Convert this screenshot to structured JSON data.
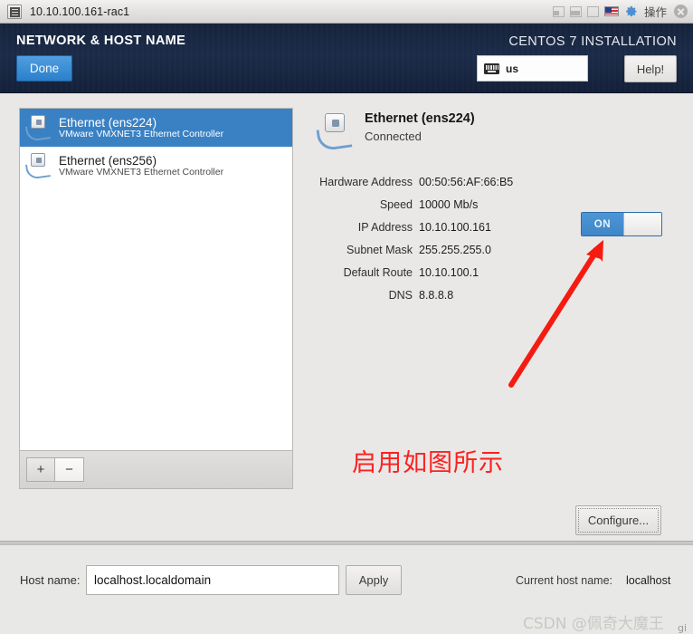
{
  "titlebar": {
    "title": "10.10.100.161-rac1",
    "icon": "terminal-icon",
    "buttons": {
      "minimize": "minimize-icon",
      "restore": "restore-icon",
      "maximize": "maximize-icon",
      "flag": "us-flag-icon",
      "gear": "gear-icon",
      "operation_label": "操作",
      "close": "close-icon"
    }
  },
  "header": {
    "screen_title": "NETWORK & HOST NAME",
    "done_label": "Done",
    "product_title": "CENTOS 7 INSTALLATION",
    "keyboard_layout": "us",
    "help_label": "Help!",
    "bg_color": "#1b2c49",
    "accent_color": "#3a81c4"
  },
  "devices": [
    {
      "name": "Ethernet (ens224)",
      "description": "VMware VMXNET3 Ethernet Controller",
      "selected": true
    },
    {
      "name": "Ethernet (ens256)",
      "description": "VMware VMXNET3 Ethernet Controller",
      "selected": false
    }
  ],
  "device_list_footer": {
    "add_label": "+",
    "remove_label": "−"
  },
  "detail": {
    "name": "Ethernet (ens224)",
    "state": "Connected",
    "toggle_label": "ON",
    "properties": [
      {
        "label": "Hardware Address",
        "value": "00:50:56:AF:66:B5"
      },
      {
        "label": "Speed",
        "value": "10000 Mb/s"
      },
      {
        "label": "IP Address",
        "value": "10.10.100.161"
      },
      {
        "label": "Subnet Mask",
        "value": "255.255.255.0"
      },
      {
        "label": "Default Route",
        "value": "10.10.100.1"
      },
      {
        "label": "DNS",
        "value": "8.8.8.8"
      }
    ],
    "configure_label": "Configure..."
  },
  "annotation": {
    "text": "启用如图所示",
    "color": "#fc2020",
    "arrow": "red-arrow-pointing-to-toggle"
  },
  "hostname": {
    "label": "Host name:",
    "value": "localhost.localdomain",
    "placeholder": "localhost.localdomain",
    "apply_label": "Apply",
    "current_label": "Current host name:",
    "current_value": "localhost"
  },
  "watermark": {
    "text": "CSDN @佩奇大魔王",
    "suffix": "gi"
  }
}
